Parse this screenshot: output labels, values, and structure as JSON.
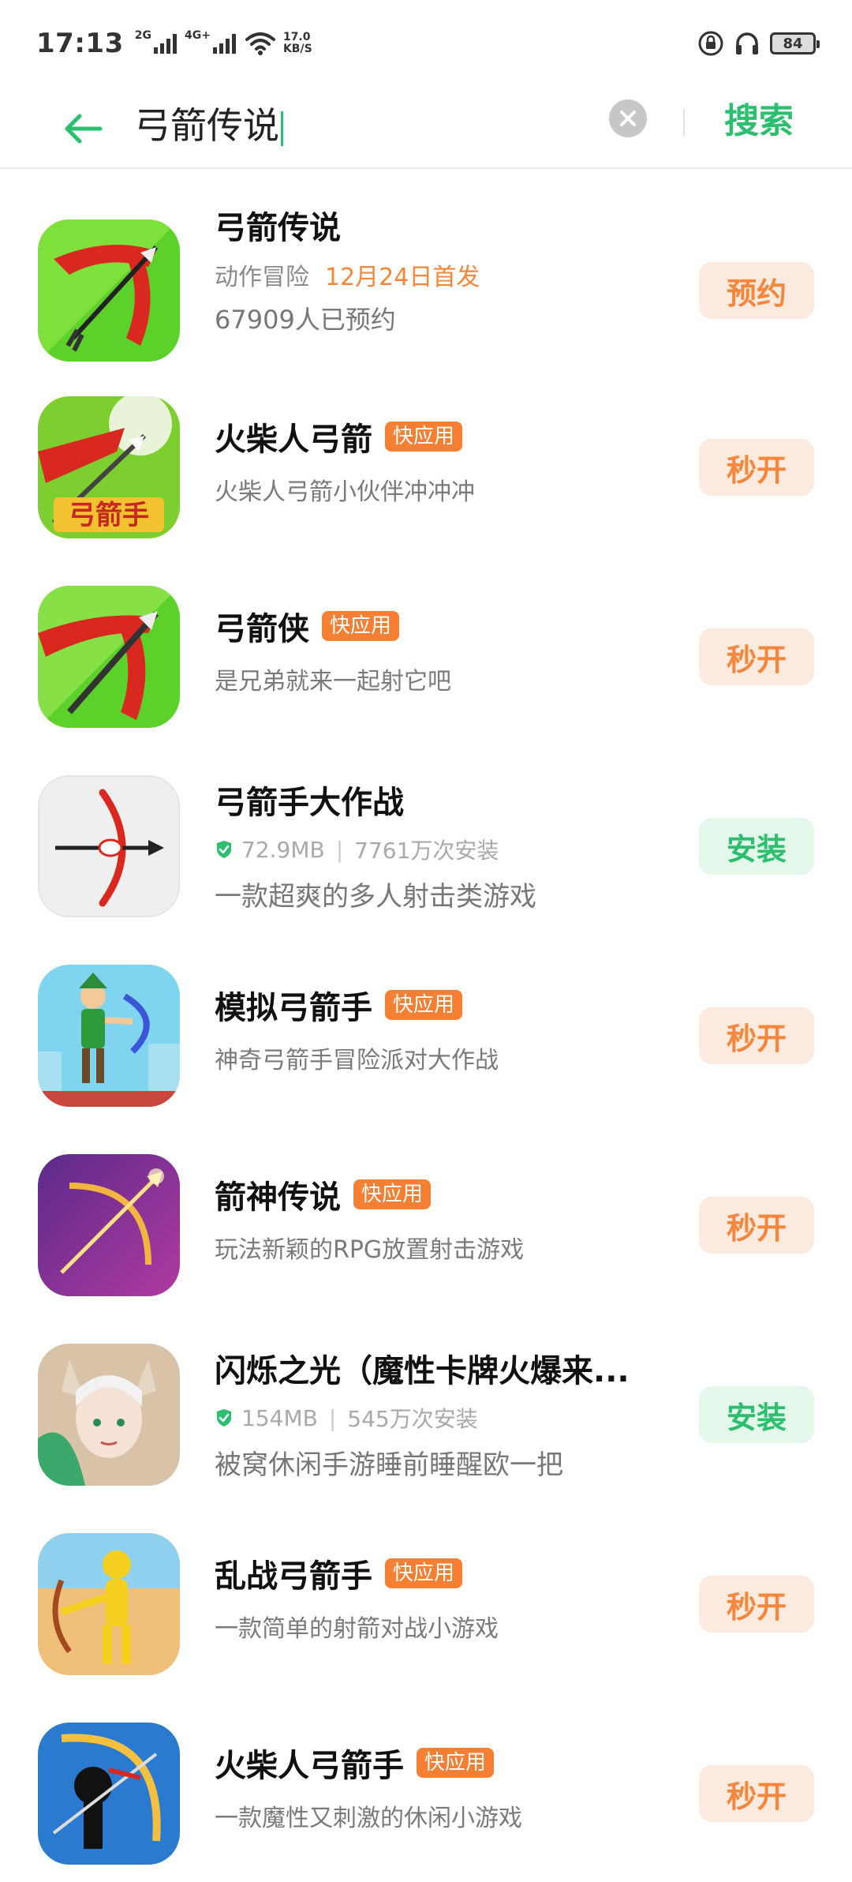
{
  "status": {
    "time": "17:13",
    "sim1": "2G",
    "sim2": "4G+",
    "speed_value": "17.0",
    "speed_unit": "KB/S",
    "battery": "84"
  },
  "search": {
    "query": "弓箭传说",
    "button": "搜索"
  },
  "colors": {
    "accent_green": "#2bbf6e",
    "accent_orange": "#f5863a",
    "badge_orange": "#f57f32"
  },
  "results": [
    {
      "name": "弓箭传说",
      "category": "动作冒险",
      "release": "12月24日首发",
      "reservations": "67909人已预约",
      "action": "预约"
    },
    {
      "name": "火柴人弓箭",
      "badge": "快应用",
      "desc": "火柴人弓箭小伙伴冲冲冲",
      "action": "秒开"
    },
    {
      "name": "弓箭侠",
      "badge": "快应用",
      "desc": "是兄弟就来一起射它吧",
      "action": "秒开"
    },
    {
      "name": "弓箭手大作战",
      "size": "72.9MB",
      "installs": "7761万次安装",
      "desc": "一款超爽的多人射击类游戏",
      "action": "安装"
    },
    {
      "name": "模拟弓箭手",
      "badge": "快应用",
      "desc": "神奇弓箭手冒险派对大作战",
      "action": "秒开"
    },
    {
      "name": "箭神传说",
      "badge": "快应用",
      "desc": "玩法新颖的RPG放置射击游戏",
      "action": "秒开"
    },
    {
      "name": "闪烁之光（魔性卡牌火爆来...",
      "size": "154MB",
      "installs": "545万次安装",
      "desc": "被窝休闲手游睡前睡醒欧一把",
      "action": "安装"
    },
    {
      "name": "乱战弓箭手",
      "badge": "快应用",
      "desc": "一款简单的射箭对战小游戏",
      "action": "秒开"
    },
    {
      "name": "火柴人弓箭手",
      "badge": "快应用",
      "desc": "一款魔性又刺激的休闲小游戏",
      "action": "秒开"
    }
  ]
}
